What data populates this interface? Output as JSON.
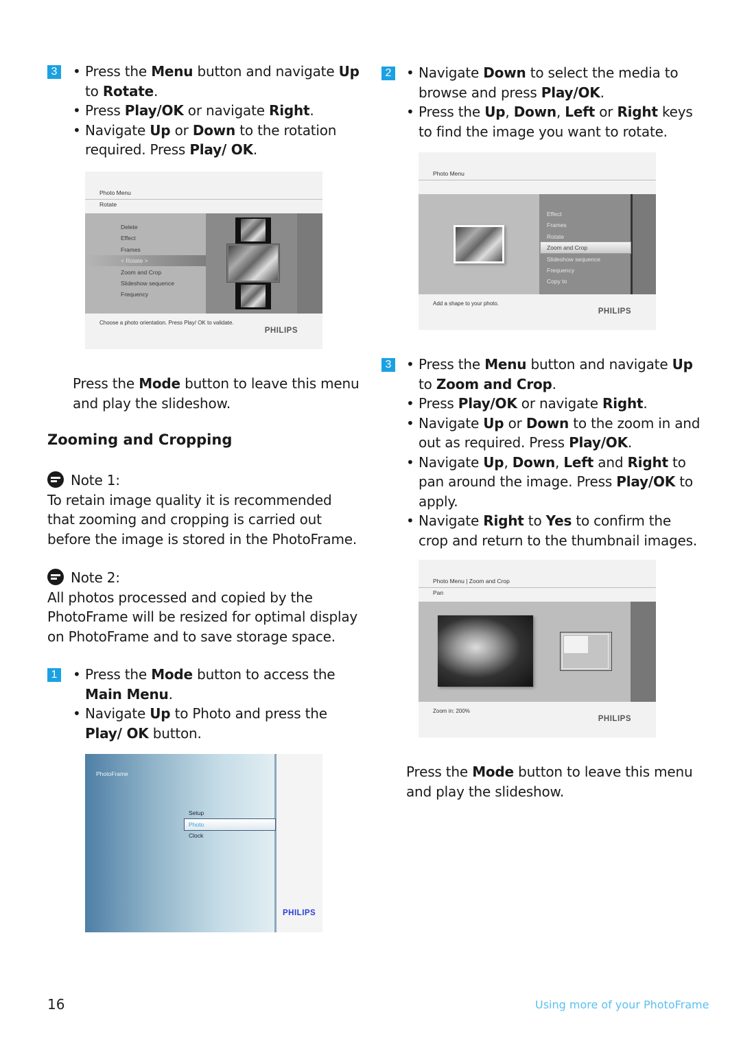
{
  "left_column": {
    "step3_rotate": {
      "badge": "3",
      "bullets": [
        [
          "Press the ",
          "Menu",
          " button and navigate ",
          "Up",
          " to ",
          "Rotate",
          "."
        ],
        [
          "Press ",
          "Play/OK",
          " or navigate ",
          "Right",
          "."
        ],
        [
          "Navigate ",
          "Up",
          " or ",
          "Down",
          " to the rotation required. Press ",
          "Play/ OK",
          "."
        ]
      ]
    },
    "screen_rotate": {
      "title": "Photo Menu",
      "subtitle": "Rotate",
      "menu_items": [
        "Delete",
        "Effect",
        "Frames",
        "< Rotate >",
        "Zoom and Crop",
        "Slideshow sequence",
        "Frequency"
      ],
      "selected_item": "< Rotate >",
      "footer": "Choose a photo orientation. Press Play/ OK to validate.",
      "logo": "PHILIPS"
    },
    "mode_text": [
      "Press the ",
      "Mode",
      " button to leave this menu and play the slideshow."
    ],
    "section_title": "Zooming and Cropping",
    "note1": {
      "label": "Note 1:",
      "text": "To retain image quality it is recommended that zooming and cropping is carried out before the image is stored in the PhotoFrame."
    },
    "note2": {
      "label": "Note 2:",
      "text": "All photos processed and copied by the PhotoFrame will be resized for optimal display on PhotoFrame and to save storage space."
    },
    "step1": {
      "badge": "1",
      "bullets": [
        [
          "Press the ",
          "Mode",
          " button to access the ",
          "Main Menu",
          "."
        ],
        [
          "Navigate ",
          "Up",
          " to Photo and press the ",
          "Play/ OK",
          " button."
        ]
      ]
    },
    "screen_main": {
      "title": "PhotoFrame",
      "menu_items": [
        "Setup",
        "Photo",
        "Clock"
      ],
      "selected_item": "Photo",
      "logo": "PHILIPS"
    }
  },
  "right_column": {
    "step2": {
      "badge": "2",
      "bullets": [
        [
          "Navigate ",
          "Down",
          " to select the media to browse and press ",
          "Play/OK",
          "."
        ],
        [
          "Press the ",
          "Up",
          ", ",
          "Down",
          ", ",
          "Left",
          " or ",
          "Right",
          " keys to find the image you want to rotate."
        ]
      ]
    },
    "screen_photo_menu": {
      "title": "Photo Menu",
      "menu_items": [
        "Effect",
        "Frames",
        "Rotate",
        "Zoom and Crop",
        "Slideshow sequence",
        "Frequency",
        "Copy to"
      ],
      "selected_item": "Zoom and Crop",
      "footer": "Add a shape to your photo.",
      "logo": "PHILIPS"
    },
    "step3_zoom": {
      "badge": "3",
      "bullets": [
        [
          "Press the ",
          "Menu",
          " button and navigate ",
          "Up",
          " to ",
          "Zoom and Crop",
          "."
        ],
        [
          "Press ",
          "Play/OK",
          " or navigate ",
          "Right",
          "."
        ],
        [
          "Navigate ",
          "Up",
          " or ",
          "Down",
          " to the zoom in and out as required. Press ",
          "Play/OK",
          "."
        ],
        [
          "Navigate ",
          "Up",
          ", ",
          "Down",
          ", ",
          "Left",
          " and ",
          "Right",
          " to pan around the image. Press ",
          "Play/OK",
          " to apply."
        ],
        [
          "Navigate ",
          "Right",
          " to ",
          "Yes",
          " to confirm the crop and return to the thumbnail images."
        ]
      ]
    },
    "screen_zoom": {
      "title": "Photo Menu | Zoom and Crop",
      "subtitle": "Pan",
      "footer": "Zoom in: 200%",
      "logo": "PHILIPS"
    },
    "mode_text": [
      "Press the ",
      "Mode",
      " button to leave this menu and play the slideshow."
    ]
  },
  "footer": {
    "page_number": "16",
    "section": "Using more of your PhotoFrame",
    "accent_color": "#5bc0f0"
  },
  "colors": {
    "step_badge": "#1ba1e2",
    "philips_blue": "#2b3fd6"
  }
}
